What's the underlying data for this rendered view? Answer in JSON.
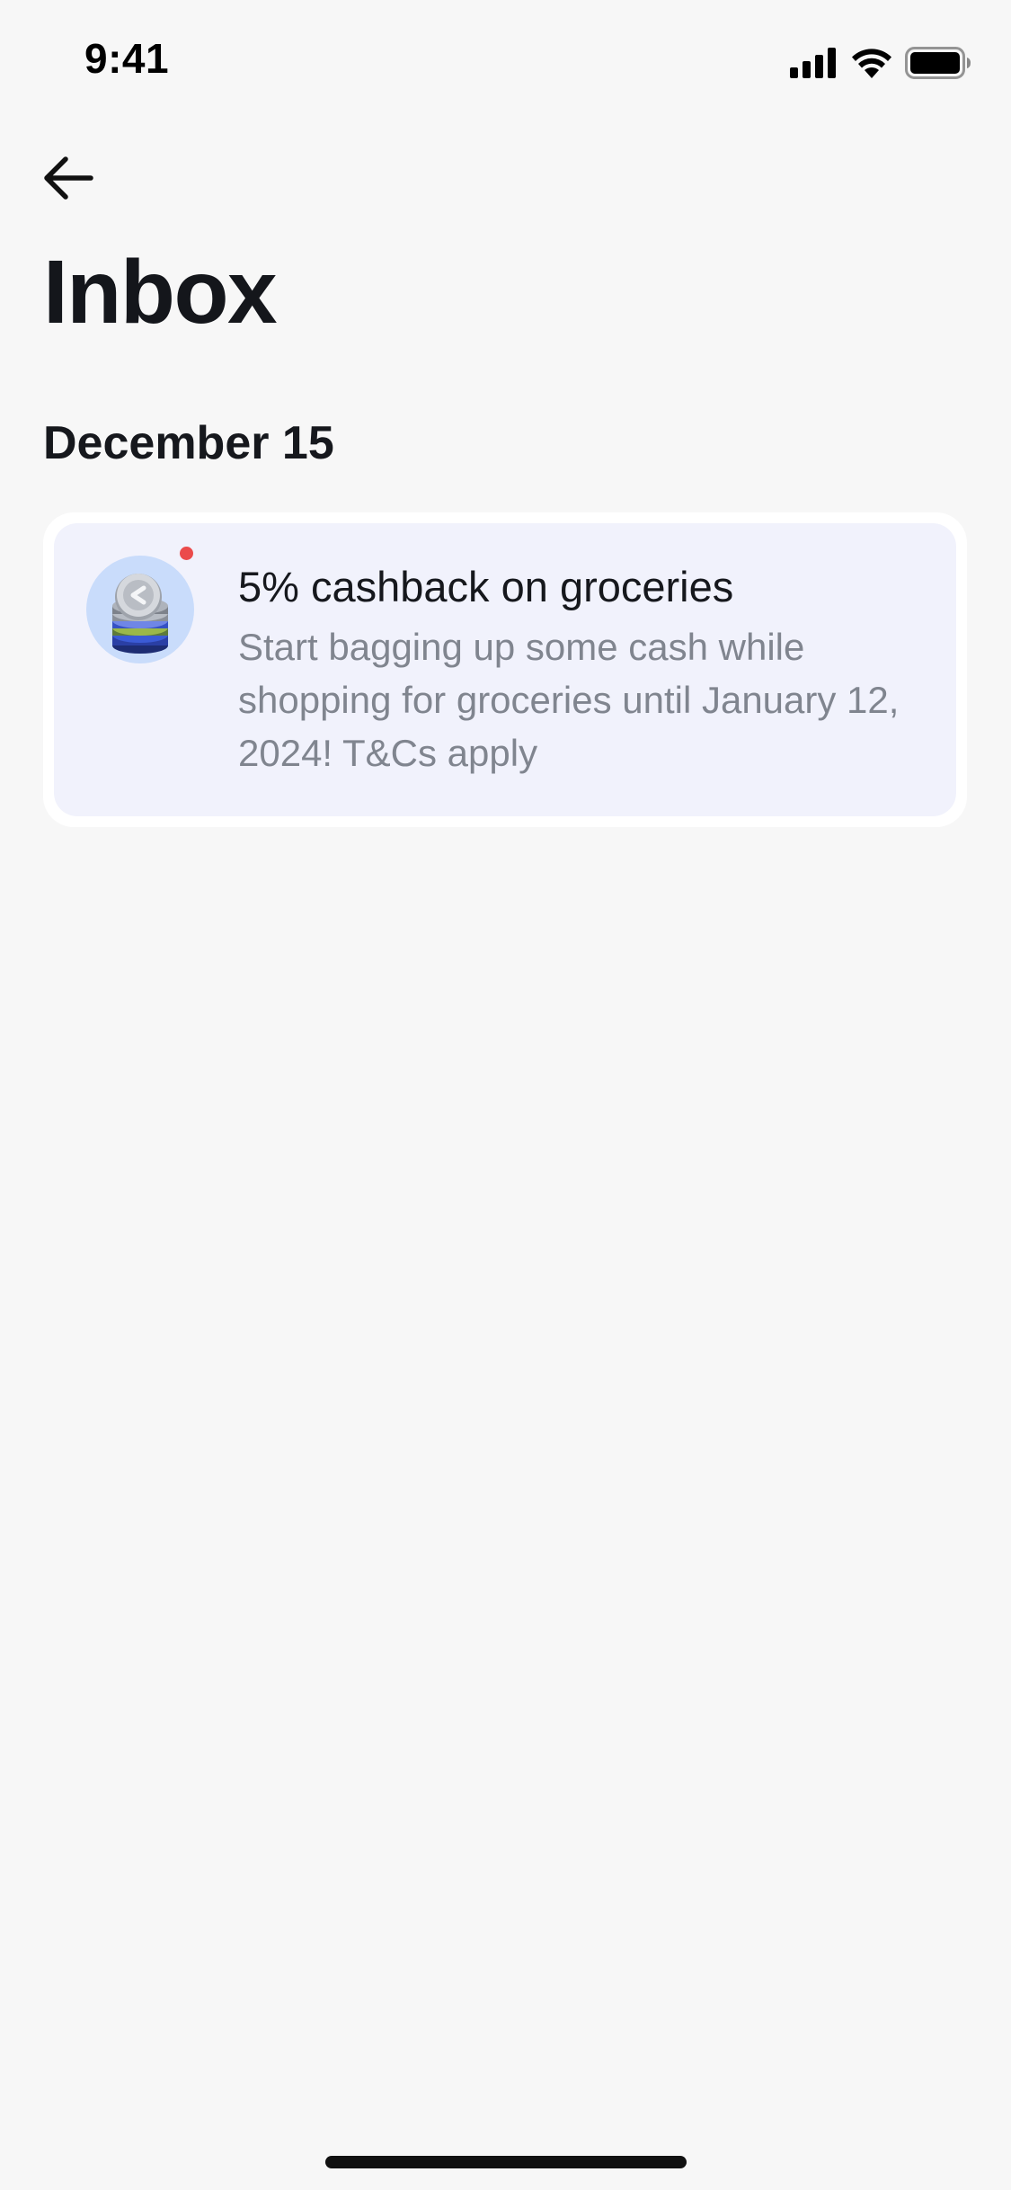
{
  "status_bar": {
    "time": "9:41"
  },
  "header": {
    "back_icon": "arrow-left-icon",
    "title": "Inbox"
  },
  "sections": [
    {
      "date": "December 15",
      "notifications": [
        {
          "icon": "cashback-coins-icon",
          "unread": true,
          "title": "5% cashback on groceries",
          "body": "Start bagging up some cash while shopping for groceries until January 12, 2024! T&Cs apply"
        }
      ]
    }
  ],
  "colors": {
    "background": "#f7f7f7",
    "card_background": "#f1f2fc",
    "icon_background": "#c9dcfb",
    "unread_dot": "#eb4b4b",
    "secondary_text": "#80858f"
  }
}
